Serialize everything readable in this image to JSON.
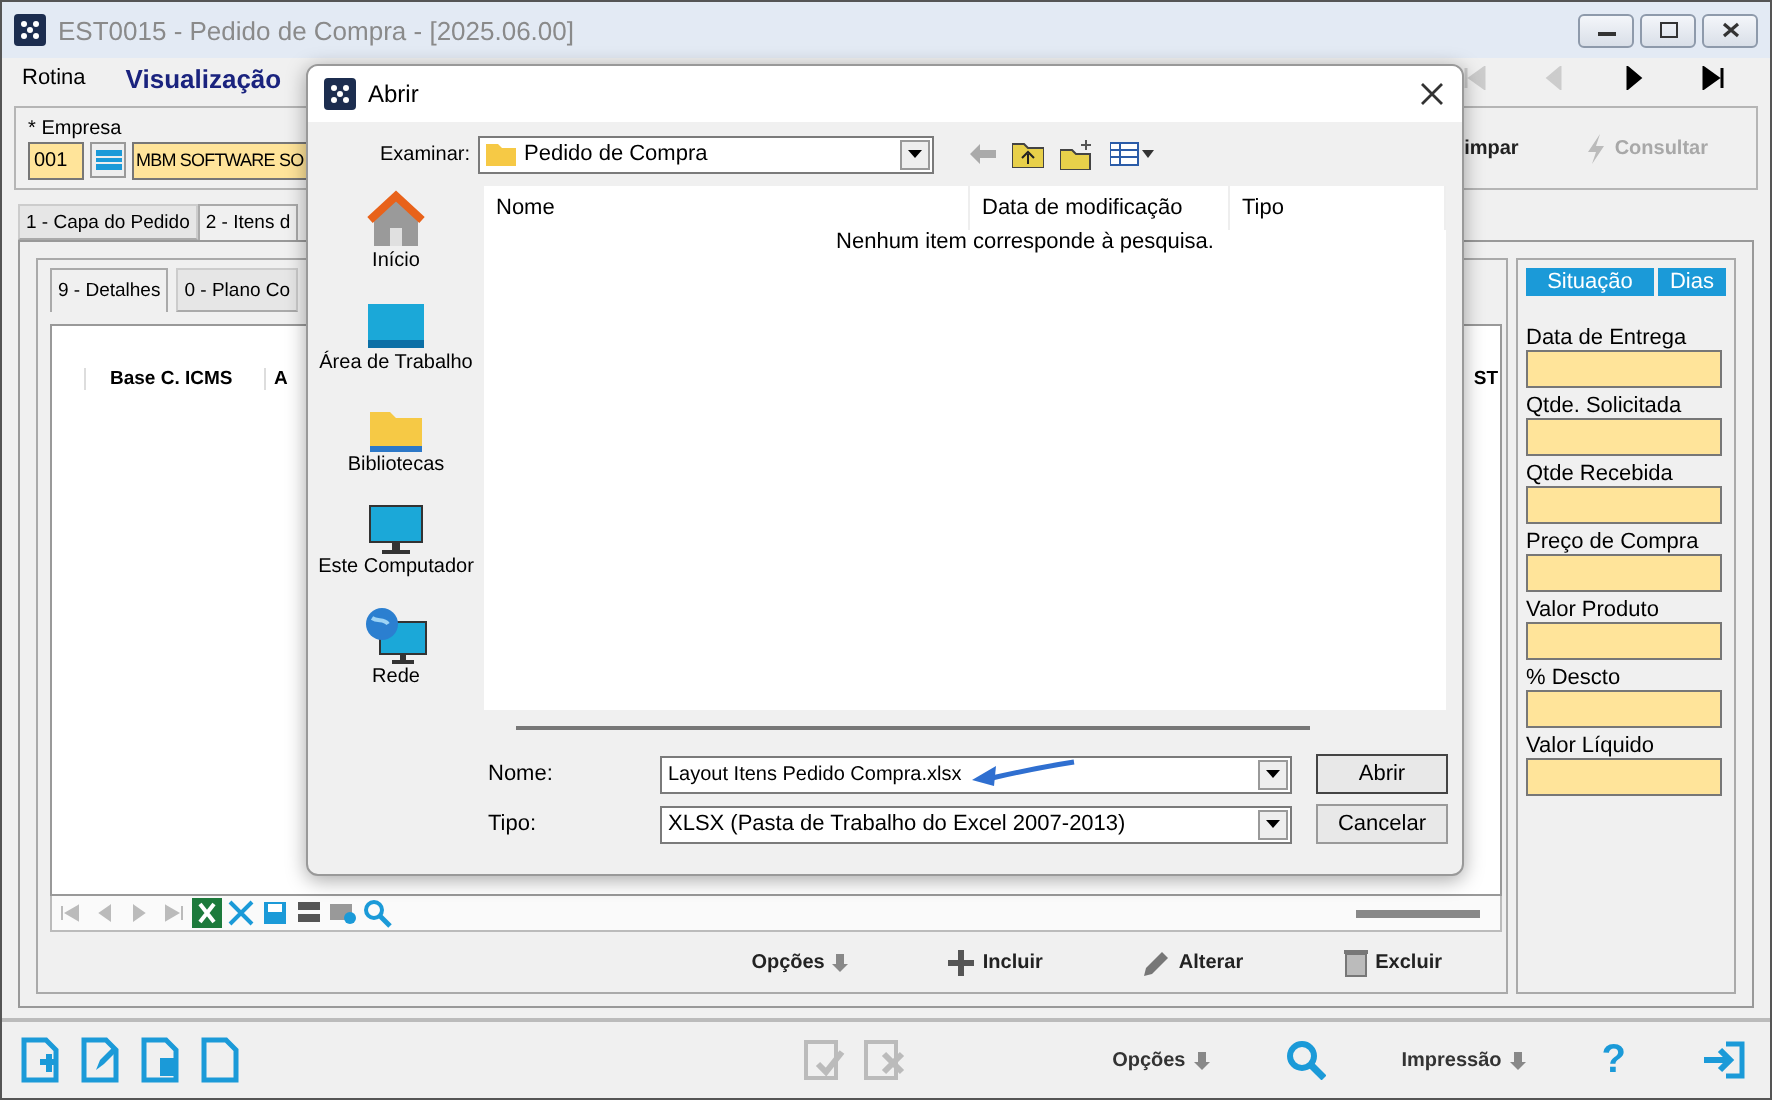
{
  "window": {
    "title": "EST0015 - Pedido de Compra - [2025.06.00]"
  },
  "menu": [
    {
      "label": "Rotina",
      "emphasized": false
    },
    {
      "label": "Visualização",
      "emphasized": true
    }
  ],
  "record_nav": [
    {
      "kind": "first",
      "disabled": true
    },
    {
      "kind": "prev",
      "disabled": true
    },
    {
      "kind": "next",
      "disabled": false
    },
    {
      "kind": "last",
      "disabled": false
    }
  ],
  "empresa": {
    "required_mark": "*",
    "label": "Empresa",
    "code": "001",
    "name": "MBM SOFTWARE SO"
  },
  "actions": [
    {
      "label": "impar",
      "kind": "clear",
      "disabled": false
    },
    {
      "label": "Consultar",
      "kind": "query",
      "disabled": true
    }
  ],
  "tabs": [
    {
      "label": "1 - Capa do Pedido",
      "selected": false
    },
    {
      "label": "2 - Itens d",
      "selected": true
    }
  ],
  "subtabs": [
    {
      "label": "9 - Detalhes",
      "selected": true
    },
    {
      "label": "0 - Plano Co",
      "selected": false
    }
  ],
  "grid": {
    "columns": [
      "Base C. ICMS",
      "A",
      "ST"
    ]
  },
  "side_panel": {
    "headers": [
      "Situação",
      "Dias"
    ],
    "fields": [
      "Data de Entrega",
      "Qtde. Solicitada",
      "Qtde Recebida",
      "Preço de Compra",
      "Valor Produto",
      "% Descto",
      "Valor Líquido"
    ]
  },
  "item_actions": [
    {
      "label": "Opções",
      "kind": "menu"
    },
    {
      "label": "Incluir",
      "kind": "add"
    },
    {
      "label": "Alterar",
      "kind": "edit"
    },
    {
      "label": "Excluir",
      "kind": "delete"
    }
  ],
  "bottom_toolbar": {
    "options": "Opções",
    "print": "Impressão",
    "help": "?"
  },
  "dialog": {
    "title": "Abrir",
    "look_in_label": "Examinar:",
    "look_in": "Pedido de Compra",
    "places": [
      {
        "label": "Início",
        "kind": "home"
      },
      {
        "label": "Área de Trabalho",
        "kind": "desktop"
      },
      {
        "label": "Bibliotecas",
        "kind": "libraries"
      },
      {
        "label": "Este Computador",
        "kind": "computer"
      },
      {
        "label": "Rede",
        "kind": "network"
      }
    ],
    "columns": [
      "Nome",
      "Data de modificação",
      "Tipo"
    ],
    "empty_message": "Nenhum item corresponde à pesquisa.",
    "name_label": "Nome:",
    "name_value": "Layout Itens Pedido Compra.xlsx",
    "type_label": "Tipo:",
    "type_value": "XLSX (Pasta de Trabalho do Excel 2007-2013)",
    "buttons": [
      "Abrir",
      "Cancelar"
    ]
  }
}
